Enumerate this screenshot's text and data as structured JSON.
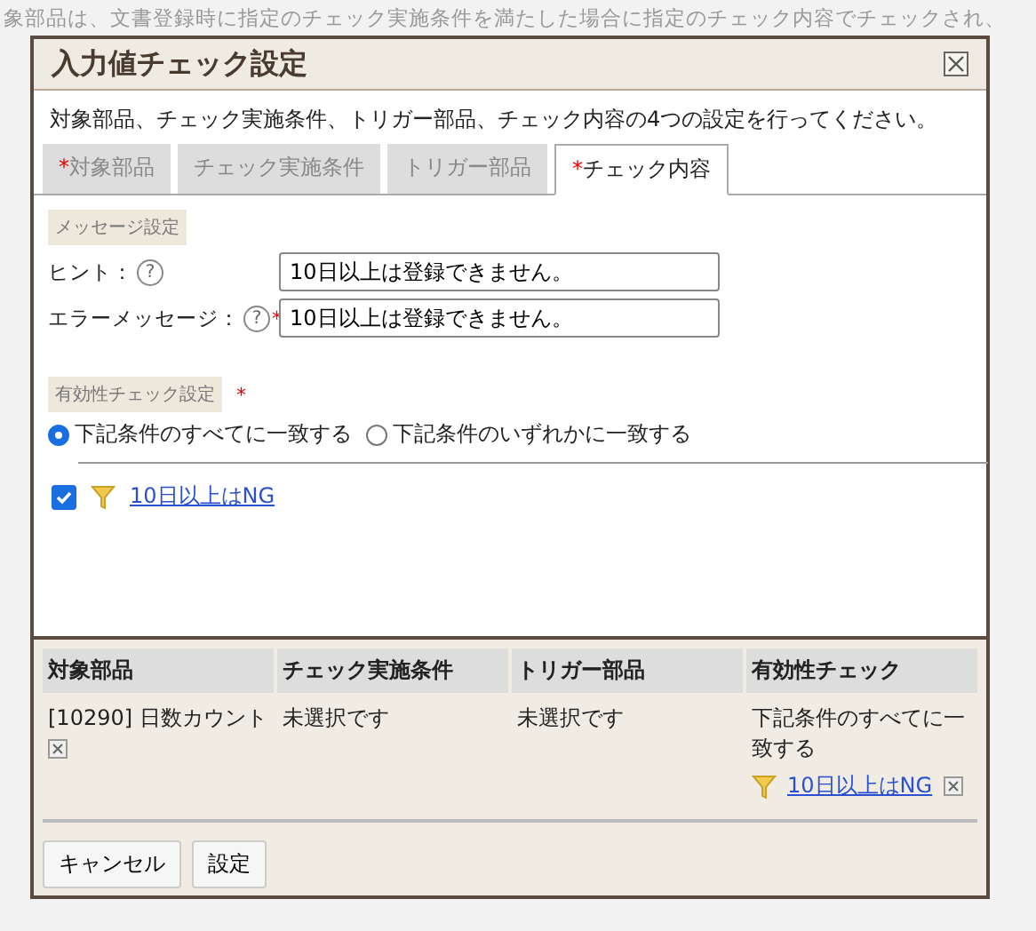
{
  "background": {
    "text": "象部品は、文書登録時に指定のチェック実施条件を満たした場合に指定のチェック内容でチェックされ、"
  },
  "required_mark": "*",
  "help_mark": "?",
  "dialog": {
    "title": "入力値チェック設定",
    "description": "対象部品、チェック実施条件、トリガー部品、チェック内容の4つの設定を行ってください。",
    "tabs": [
      {
        "label": "対象部品",
        "required": true,
        "selected": false
      },
      {
        "label": "チェック実施条件",
        "required": false,
        "selected": false
      },
      {
        "label": "トリガー部品",
        "required": false,
        "selected": false
      },
      {
        "label": "チェック内容",
        "required": true,
        "selected": true
      }
    ],
    "message_section": {
      "heading": "メッセージ設定",
      "fields": [
        {
          "label": "ヒント：",
          "required": false,
          "value": "10日以上は登録できません。"
        },
        {
          "label": "エラーメッセージ：",
          "required": true,
          "value": "10日以上は登録できません。"
        }
      ]
    },
    "validity_section": {
      "heading": "有効性チェック設定",
      "required": true,
      "options": [
        {
          "label": "下記条件のすべてに一致する",
          "selected": true
        },
        {
          "label": "下記条件のいずれかに一致する",
          "selected": false
        }
      ],
      "conditions": [
        {
          "label": "10日以上はNG",
          "checked": true
        }
      ]
    },
    "summary": {
      "columns": [
        "対象部品",
        "チェック実施条件",
        "トリガー部品",
        "有効性チェック"
      ],
      "row": {
        "target": "[10290] 日数カウント",
        "condition": "未選択です",
        "trigger": "未選択です",
        "validity": "下記条件のすべてに一致する",
        "validity_link": "10日以上はNG"
      }
    },
    "buttons": [
      "キャンセル",
      "設定"
    ]
  }
}
